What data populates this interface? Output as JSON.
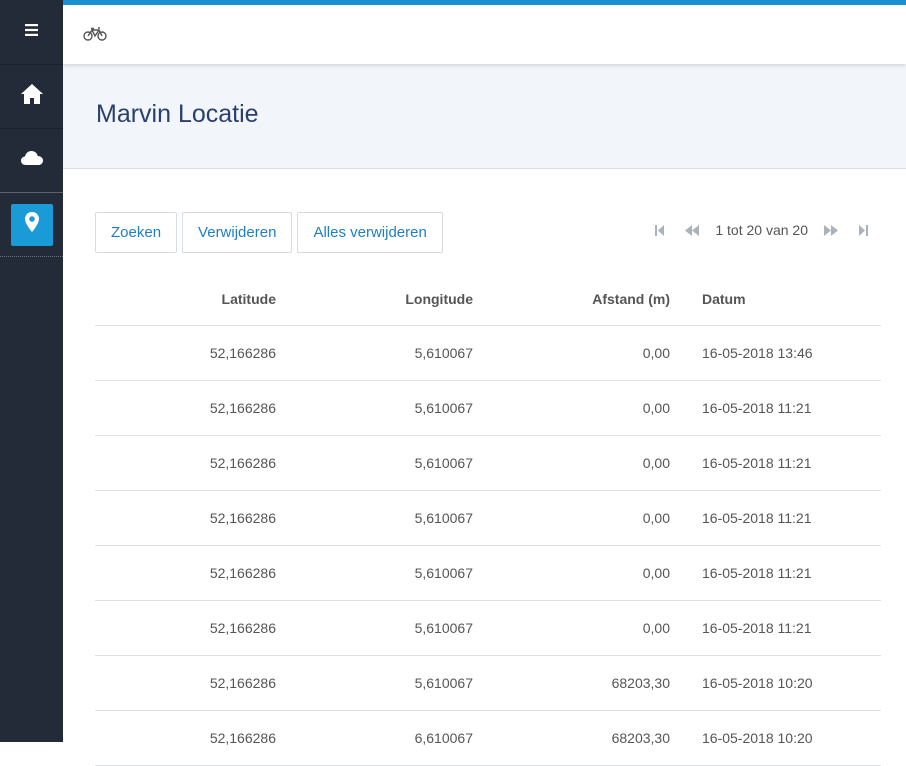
{
  "colors": {
    "sidebar_bg": "#242b38",
    "accent": "#1a9bd7",
    "top_border": "#1a8fd1",
    "title_color": "#2a3f6e",
    "button_text": "#1e7fc4"
  },
  "sidebar": {
    "items": [
      {
        "icon": "menu-icon"
      },
      {
        "icon": "home-icon"
      },
      {
        "icon": "cloud-icon"
      },
      {
        "icon": "location-pin-icon",
        "active": true
      }
    ]
  },
  "topbar": {
    "icon": "bicycle-icon"
  },
  "page": {
    "title": "Marvin Locatie"
  },
  "toolbar": {
    "search_label": "Zoeken",
    "delete_label": "Verwijderen",
    "delete_all_label": "Alles verwijderen"
  },
  "pager": {
    "text": "1 tot 20 van 20"
  },
  "table": {
    "headers": [
      "Latitude",
      "Longitude",
      "Afstand (m)",
      "Datum"
    ],
    "rows": [
      [
        "52,166286",
        "5,610067",
        "0,00",
        "16-05-2018 13:46"
      ],
      [
        "52,166286",
        "5,610067",
        "0,00",
        "16-05-2018 11:21"
      ],
      [
        "52,166286",
        "5,610067",
        "0,00",
        "16-05-2018 11:21"
      ],
      [
        "52,166286",
        "5,610067",
        "0,00",
        "16-05-2018 11:21"
      ],
      [
        "52,166286",
        "5,610067",
        "0,00",
        "16-05-2018 11:21"
      ],
      [
        "52,166286",
        "5,610067",
        "0,00",
        "16-05-2018 11:21"
      ],
      [
        "52,166286",
        "5,610067",
        "68203,30",
        "16-05-2018 10:20"
      ],
      [
        "52,166286",
        "6,610067",
        "68203,30",
        "16-05-2018 10:20"
      ]
    ]
  }
}
